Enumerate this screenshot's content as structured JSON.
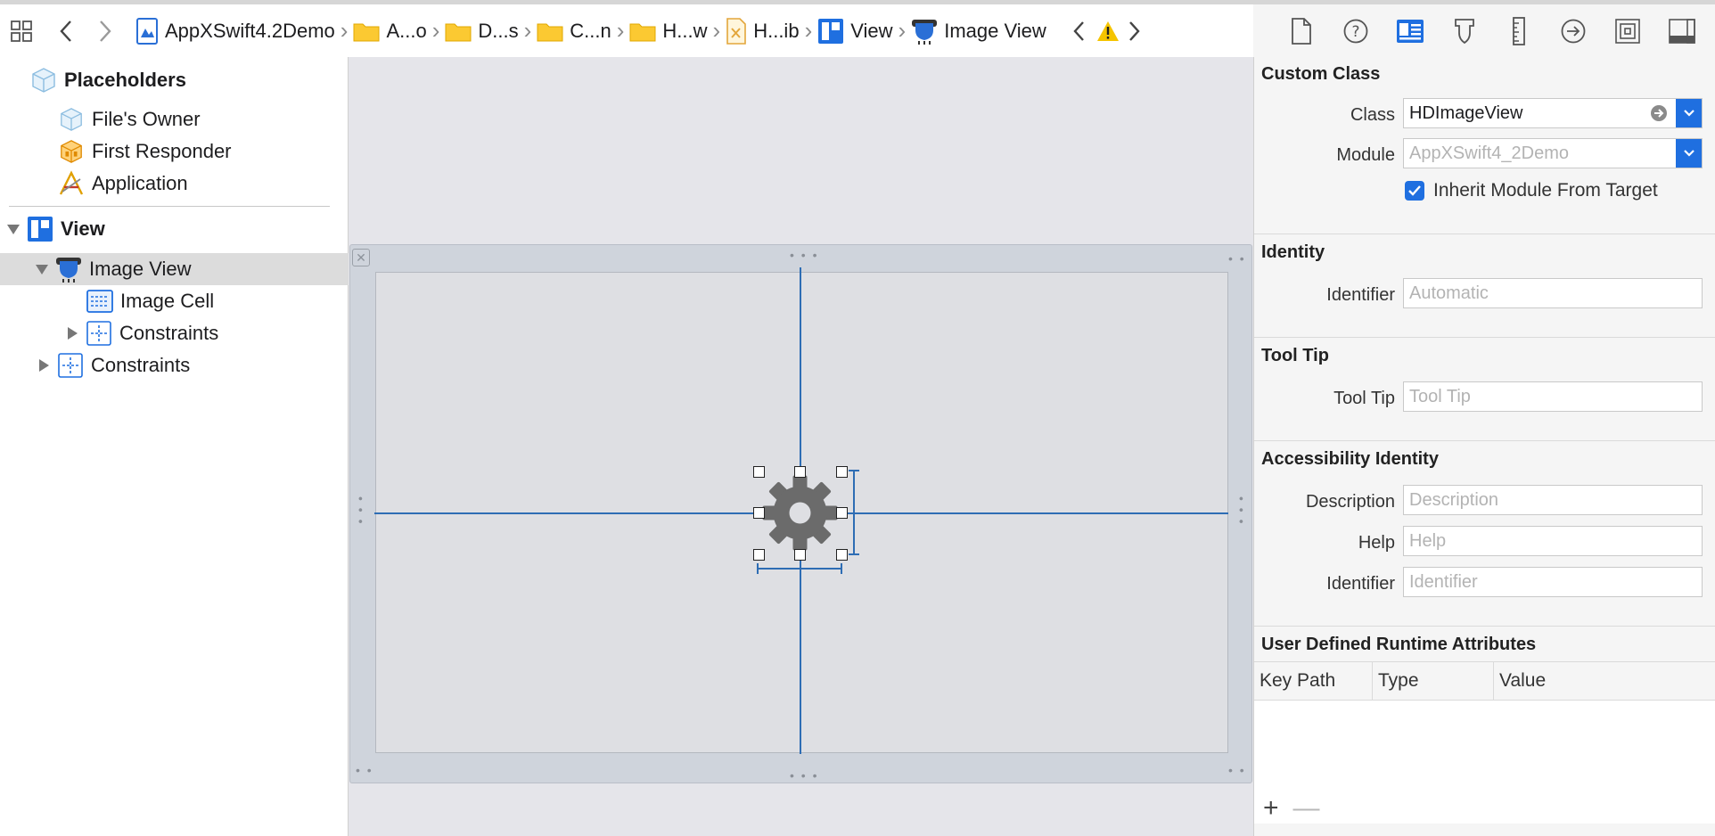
{
  "breadcrumb": {
    "items": [
      {
        "label": "AppXSwift4.2Demo",
        "icon": "project-icon"
      },
      {
        "label": "A...o",
        "icon": "folder-icon"
      },
      {
        "label": "D...s",
        "icon": "folder-icon"
      },
      {
        "label": "C...n",
        "icon": "folder-icon"
      },
      {
        "label": "H...w",
        "icon": "folder-icon"
      },
      {
        "label": "H...ib",
        "icon": "xib-file-icon"
      },
      {
        "label": "View",
        "icon": "view-icon"
      },
      {
        "label": "Image View",
        "icon": "image-view-icon"
      }
    ]
  },
  "navigator": {
    "placeholders_title": "Placeholders",
    "placeholders": [
      "File's Owner",
      "First Responder",
      "Application"
    ],
    "view_label": "View",
    "image_view_label": "Image View",
    "image_cell_label": "Image Cell",
    "constraints_inner_label": "Constraints",
    "constraints_outer_label": "Constraints"
  },
  "inspector": {
    "custom_class": {
      "title": "Custom Class",
      "class_label": "Class",
      "class_value": "HDImageView",
      "module_label": "Module",
      "module_placeholder": "AppXSwift4_2Demo",
      "inherit_label": "Inherit Module From Target",
      "inherit_checked": true
    },
    "identity": {
      "title": "Identity",
      "identifier_label": "Identifier",
      "identifier_placeholder": "Automatic"
    },
    "tool_tip": {
      "title": "Tool Tip",
      "label": "Tool Tip",
      "placeholder": "Tool Tip"
    },
    "accessibility": {
      "title": "Accessibility Identity",
      "description_label": "Description",
      "description_placeholder": "Description",
      "help_label": "Help",
      "help_placeholder": "Help",
      "identifier_label": "Identifier",
      "identifier_placeholder": "Identifier"
    },
    "runtime_attributes": {
      "title": "User Defined Runtime Attributes",
      "columns": [
        "Key Path",
        "Type",
        "Value"
      ],
      "add_symbol": "+",
      "remove_symbol": "—"
    }
  },
  "colors": {
    "accent": "#1f6fe0",
    "guide": "#2e6db4",
    "selection": "#dcdcdc",
    "warning": "#f5c400"
  }
}
